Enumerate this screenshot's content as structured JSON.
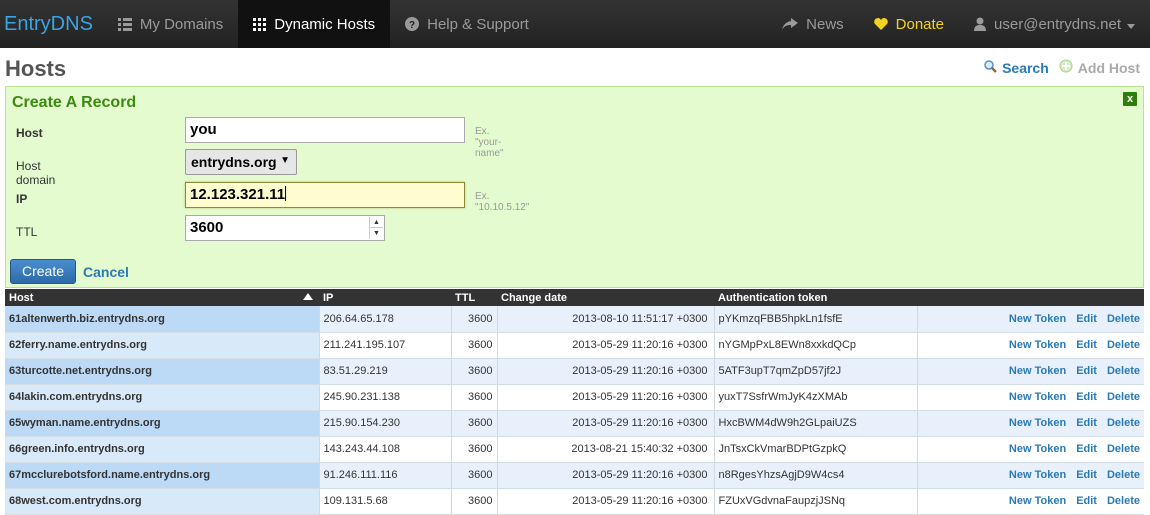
{
  "nav": {
    "brand": "EntryDNS",
    "items": [
      {
        "label": "My Domains",
        "icon": "grid-list-icon"
      },
      {
        "label": "Dynamic Hosts",
        "icon": "grid-icon",
        "active": true
      },
      {
        "label": "Help & Support",
        "icon": "question-circle-icon"
      }
    ],
    "right": [
      {
        "label": "News",
        "icon": "share-arrow-icon"
      },
      {
        "label": "Donate",
        "icon": "heart-icon"
      },
      {
        "label": "user@entrydns.net",
        "icon": "user-icon"
      }
    ],
    "colors": {
      "brand": "#3aa3e3",
      "donate": "#f3d31f"
    }
  },
  "page": {
    "title": "Hosts",
    "search_label": "Search",
    "add_host_label": "Add Host"
  },
  "form": {
    "title": "Create A Record",
    "close_label": "x",
    "host_label": "Host",
    "host_value": "you",
    "host_hint": "Ex. \"your-name\"",
    "domain_label": "Host domain",
    "domain_value": "entrydns.org",
    "ip_label": "IP",
    "ip_value": "12.123.321.11",
    "ip_hint": "Ex. \"10.10.5.12\"",
    "ttl_label": "TTL",
    "ttl_value": "3600",
    "create_label": "Create",
    "cancel_label": "Cancel"
  },
  "table": {
    "headers": [
      "Host",
      "IP",
      "TTL",
      "Change date",
      "Authentication token"
    ],
    "action_labels": {
      "new_token": "New Token",
      "edit": "Edit",
      "delete": "Delete"
    },
    "rows": [
      {
        "host": "61altenwerth.biz.entrydns.org",
        "ip": "206.64.65.178",
        "ttl": "3600",
        "date": "2013-08-10 11:51:17 +0300",
        "token": "pYKmzqFBB5hpkLn1fsfE"
      },
      {
        "host": "62ferry.name.entrydns.org",
        "ip": "211.241.195.107",
        "ttl": "3600",
        "date": "2013-05-29 11:20:16 +0300",
        "token": "nYGMpPxL8EWn8xxkdQCp"
      },
      {
        "host": "63turcotte.net.entrydns.org",
        "ip": "83.51.29.219",
        "ttl": "3600",
        "date": "2013-05-29 11:20:16 +0300",
        "token": "5ATF3upT7qmZpD57jf2J"
      },
      {
        "host": "64lakin.com.entrydns.org",
        "ip": "245.90.231.138",
        "ttl": "3600",
        "date": "2013-05-29 11:20:16 +0300",
        "token": "yuxT7SsfrWmJyK4zXMAb"
      },
      {
        "host": "65wyman.name.entrydns.org",
        "ip": "215.90.154.230",
        "ttl": "3600",
        "date": "2013-05-29 11:20:16 +0300",
        "token": "HxcBWM4dW9h2GLpaiUZS"
      },
      {
        "host": "66green.info.entrydns.org",
        "ip": "143.243.44.108",
        "ttl": "3600",
        "date": "2013-08-21 15:40:32 +0300",
        "token": "JnTsxCkVmarBDPtGzpkQ"
      },
      {
        "host": "67mcclurebotsford.name.entrydns.org",
        "ip": "91.246.111.116",
        "ttl": "3600",
        "date": "2013-05-29 11:20:16 +0300",
        "token": "n8RgesYhzsAgjD9W4cs4"
      },
      {
        "host": "68west.com.entrydns.org",
        "ip": "109.131.5.68",
        "ttl": "3600",
        "date": "2013-05-29 11:20:16 +0300",
        "token": "FZUxVGdvnaFaupzjJSNq"
      }
    ]
  }
}
